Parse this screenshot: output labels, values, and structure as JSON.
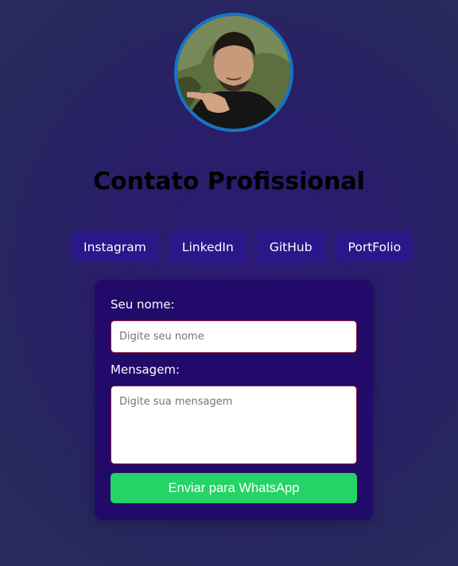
{
  "profile": {
    "avatar_icon": "profile-photo",
    "avatar_border_color": "#1575c6"
  },
  "title": "Contato Profissional",
  "social_links": [
    {
      "label": "Instagram"
    },
    {
      "label": "LinkedIn"
    },
    {
      "label": "GitHub"
    },
    {
      "label": "PortFolio"
    }
  ],
  "form": {
    "name_label": "Seu nome:",
    "name_placeholder": "Digite seu nome",
    "name_value": "",
    "message_label": "Mensagem:",
    "message_placeholder": "Digite sua mensagem",
    "message_value": "",
    "submit_label": "Enviar para WhatsApp"
  },
  "colors": {
    "background": "#292066",
    "card": "#220a6a",
    "link_button": "#2a1789",
    "submit": "#25d366",
    "input_border": "#8e1d3a"
  }
}
